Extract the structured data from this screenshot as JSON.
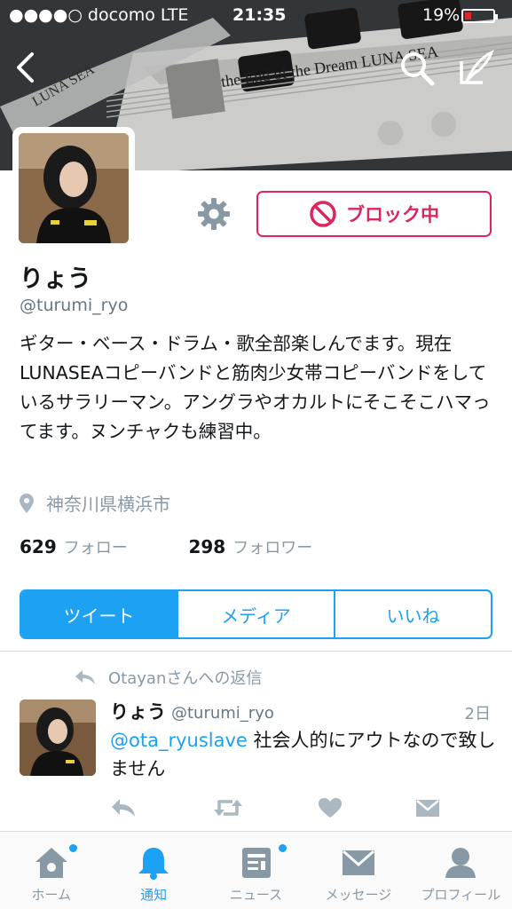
{
  "status_bar": {
    "carrier": "●●●●○ docomo  LTE",
    "time": "21:35",
    "battery": "19%"
  },
  "header_art": {
    "text1": "LUNA SEA",
    "text2": "the End of the Dream  LUNA SEA"
  },
  "profile": {
    "name": "りょう",
    "handle": "@turumi_ryo",
    "block_label": "ブロック中",
    "bio": "ギター・ベース・ドラム・歌全部楽しんでます。現在LUNASEAコピーバンドと筋肉少女帯コピーバンドをしているサラリーマン。アングラやオカルトにそこそこハマってます。ヌンチャクも練習中。",
    "location": "神奈川県横浜市",
    "following_count": "629",
    "following_label": "フォロー",
    "followers_count": "298",
    "followers_label": "フォロワー"
  },
  "tabs": [
    {
      "label": "ツイート"
    },
    {
      "label": "メディア"
    },
    {
      "label": "いいね"
    }
  ],
  "tweet": {
    "reply_context": "Otayanさんへの返信",
    "name": "りょう",
    "handle": "@turumi_ryo",
    "time": "2日",
    "mention": "@ota_ryuslave",
    "text": " 社会人的にアウトなので致しません"
  },
  "tabbar": [
    {
      "label": "ホーム"
    },
    {
      "label": "通知"
    },
    {
      "label": "ニュース"
    },
    {
      "label": "メッセージ"
    },
    {
      "label": "プロフィール"
    }
  ],
  "colors": {
    "accent": "#1da1f2",
    "block": "#e0245e",
    "muted": "#8899a6"
  }
}
